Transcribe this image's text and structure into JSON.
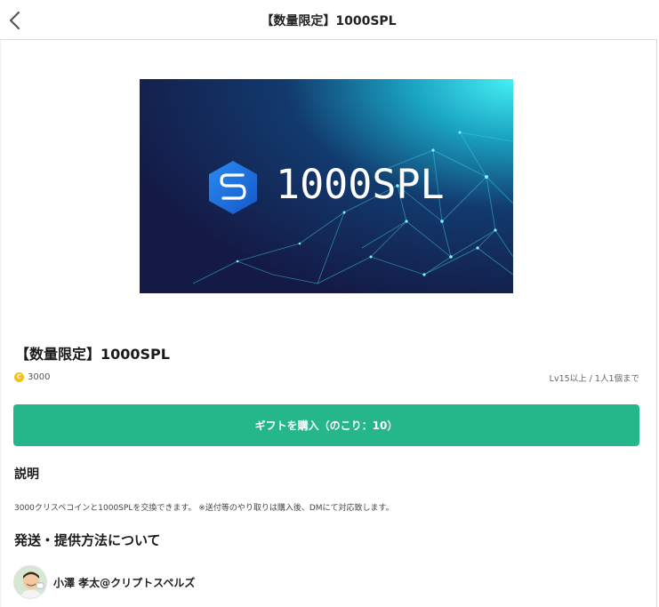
{
  "header": {
    "title": "【数量限定】1000SPL",
    "back_icon": "chevron-left-icon"
  },
  "banner": {
    "text": "1000SPL",
    "logo_icon": "hexagon-s-logo",
    "colors": {
      "bg_dark": "#141a45",
      "glow": "#3ee8f0",
      "logo": "#1f78e8"
    }
  },
  "product": {
    "title": "【数量限定】1000SPL",
    "coin_icon": "coin-icon",
    "coin_symbol": "C",
    "price": "3000",
    "limit": "Lv15以上 /  1人1個まで"
  },
  "buy_button": {
    "label": "ギフトを購入（のこり：10）",
    "color": "#25b68a"
  },
  "description": {
    "heading": "説明",
    "text": "3000クリスペコインと1000SPLを交換できます。 ※送付等のやり取りは購入後、DMにて対応致します。"
  },
  "shipping": {
    "heading": "発送・提供方法について"
  },
  "seller": {
    "name": "小澤 孝太@クリプトスペルズ",
    "avatar_icon": "avatar"
  }
}
